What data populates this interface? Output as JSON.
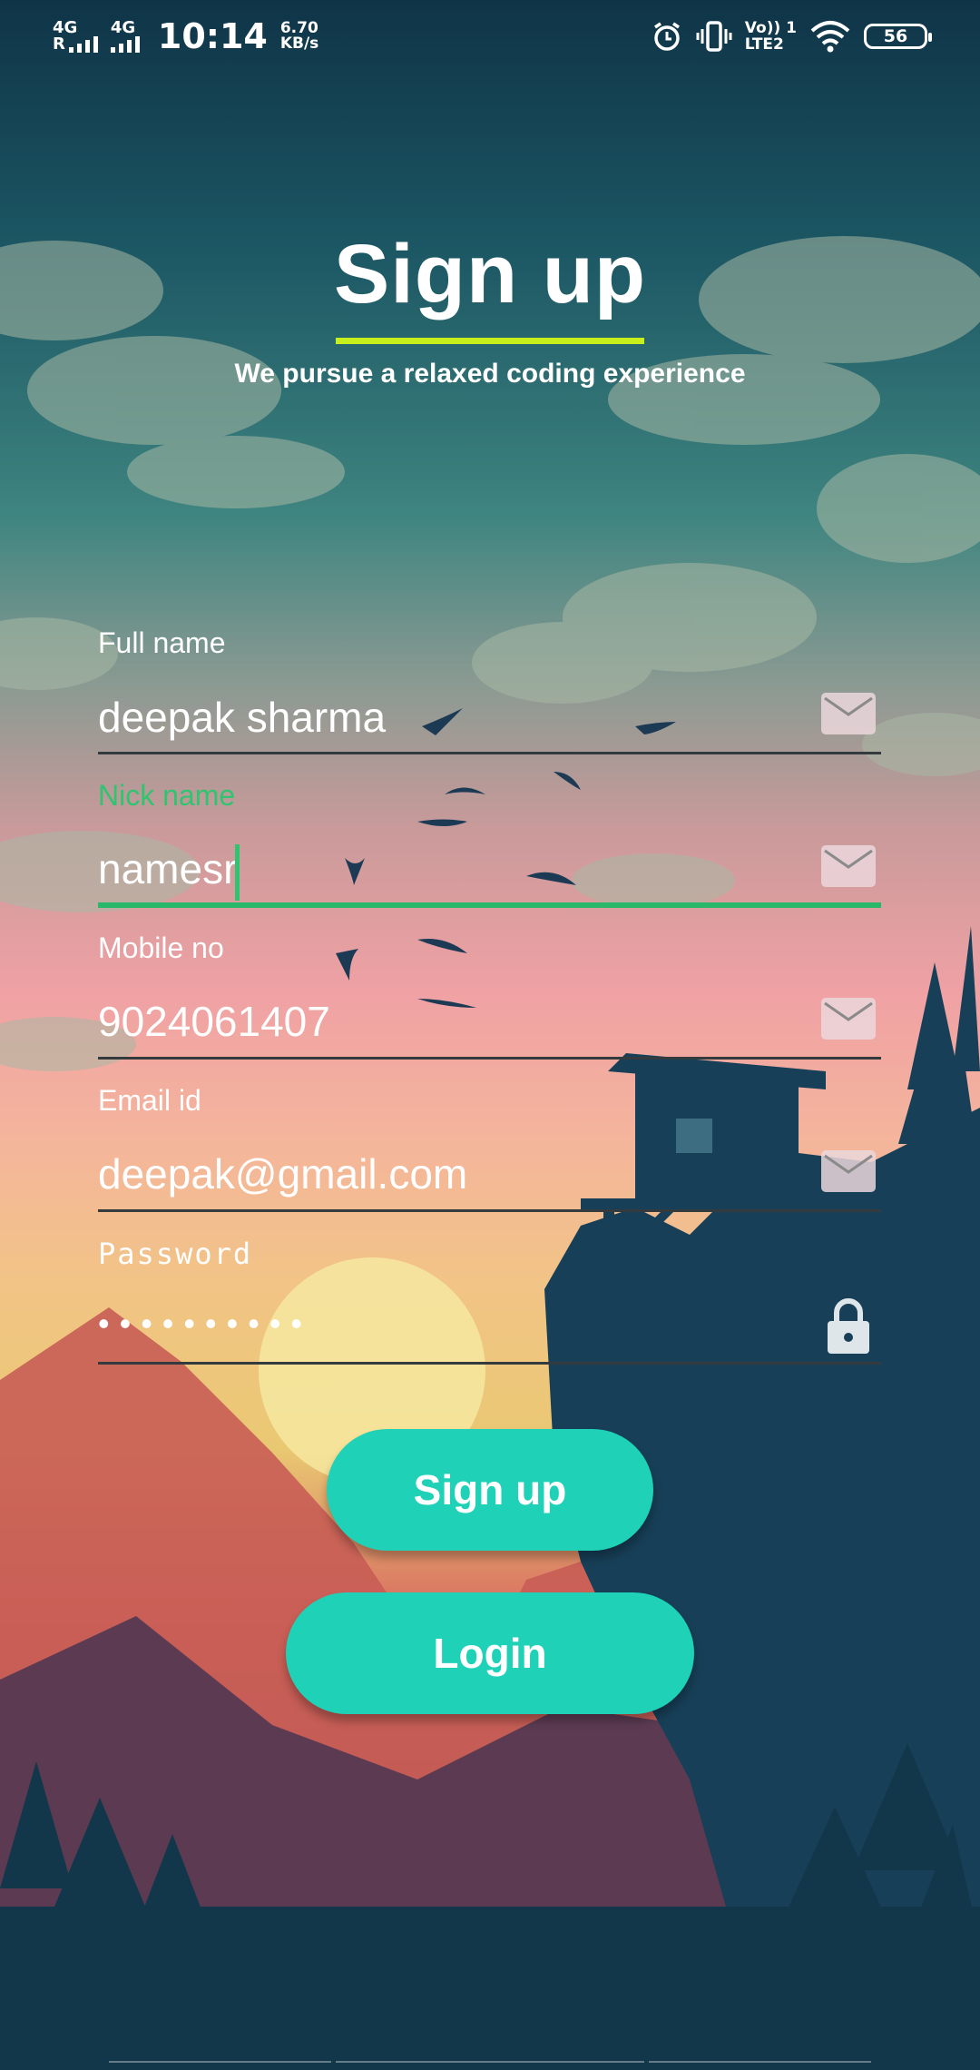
{
  "status_bar": {
    "sim1_network": "4G",
    "sim1_r": "R",
    "sim2_network": "4G",
    "time": "10:14",
    "speed_value": "6.70",
    "speed_unit": "KB/s",
    "alarm_icon": "alarm-icon",
    "vibrate_icon": "vibrate-icon",
    "volte_top": "Vo)) 1",
    "volte_bottom": "LTE2",
    "wifi_icon": "wifi-icon",
    "battery": "56"
  },
  "header": {
    "title": "Sign up",
    "subtitle": "We pursue a relaxed coding experience"
  },
  "form": {
    "full_name": {
      "label": "Full name",
      "value": "deepak sharma",
      "icon": "mail-icon"
    },
    "nick_name": {
      "label": "Nick name",
      "value": "namesr",
      "icon": "mail-icon"
    },
    "mobile": {
      "label": "Mobile no",
      "value": "9024061407",
      "icon": "mail-icon"
    },
    "email": {
      "label": "Email id",
      "value": "deepak@gmail.com",
      "icon": "mail-icon"
    },
    "password": {
      "label": "Password",
      "value": "••••••••••",
      "icon": "lock-icon"
    }
  },
  "buttons": {
    "signup": "Sign up",
    "login": "Login"
  },
  "colors": {
    "accent": "#1fd1b7",
    "underline": "#c6ef1c",
    "focus": "#2fc46f"
  }
}
